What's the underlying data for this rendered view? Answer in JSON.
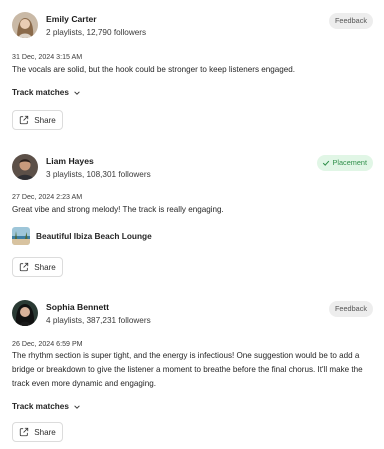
{
  "comments": [
    {
      "name": "Emily Carter",
      "followers": "2 playlists, 12,790 followers",
      "badge": "Feedback",
      "date": "31 Dec, 2024 3:15 AM",
      "text": "The vocals are solid, but the hook could be stronger to keep listeners engaged.",
      "matches_label": "Track matches",
      "share_label": "Share"
    },
    {
      "name": "Liam Hayes",
      "followers": "3 playlists, 108,301 followers",
      "badge": "Placement",
      "date": "27 Dec, 2024 2:23 AM",
      "text": "Great vibe and strong melody! The track is really engaging.",
      "track_name": "Beautiful Ibiza Beach Lounge",
      "share_label": "Share"
    },
    {
      "name": "Sophia Bennett",
      "followers": "4 playlists, 387,231 followers",
      "badge": "Feedback",
      "date": "26 Dec, 2024 6:59 PM",
      "text": "The rhythm section is super tight, and the energy is infectious! One suggestion would be to add a bridge or breakdown to give the listener a moment to breathe before the final chorus. It'll make the track even more dynamic and engaging.",
      "matches_label": "Track matches",
      "share_label": "Share"
    }
  ],
  "icons": {
    "share": "share-icon",
    "chevron": "chevron-down-icon",
    "check": "check-icon"
  },
  "colors": {
    "placement_bg": "#e1f6e6",
    "placement_text": "#2f8f4a",
    "feedback_bg": "#ededed"
  }
}
